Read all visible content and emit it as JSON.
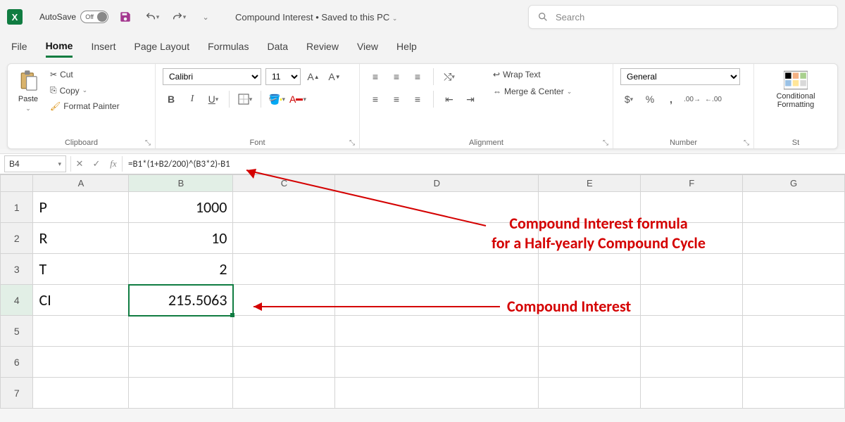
{
  "titlebar": {
    "autosave_label": "AutoSave",
    "autosave_state": "Off",
    "doc_title": "Compound Interest • Saved to this PC",
    "search_placeholder": "Search"
  },
  "tabs": [
    "File",
    "Home",
    "Insert",
    "Page Layout",
    "Formulas",
    "Data",
    "Review",
    "View",
    "Help"
  ],
  "active_tab": "Home",
  "ribbon": {
    "clipboard": {
      "paste": "Paste",
      "cut": "Cut",
      "copy": "Copy",
      "painter": "Format Painter",
      "label": "Clipboard"
    },
    "font": {
      "name": "Calibri",
      "size": "11",
      "label": "Font",
      "bold": "B",
      "italic": "I",
      "underline": "U"
    },
    "alignment": {
      "wrap": "Wrap Text",
      "merge": "Merge & Center",
      "label": "Alignment"
    },
    "number": {
      "format": "General",
      "label": "Number"
    },
    "styles": {
      "cond": "Conditional Formatting",
      "label": "St"
    }
  },
  "formula_bar": {
    "cell_ref": "B4",
    "formula": "=B1*(1+B2/200)^(B3*2)-B1"
  },
  "columns": [
    "A",
    "B",
    "C",
    "D",
    "E",
    "F",
    "G"
  ],
  "rows": [
    1,
    2,
    3,
    4,
    5,
    6,
    7
  ],
  "cells": {
    "A1": "P",
    "B1": "1000",
    "A2": "R",
    "B2": "10",
    "A3": "T",
    "B3": "2",
    "A4": "CI",
    "B4": "215.5063"
  },
  "active_cell": "B4",
  "annotations": {
    "formula_note": "Compound Interest formula\nfor a Half-yearly Compound Cycle",
    "ci_note": "Compound Interest"
  }
}
